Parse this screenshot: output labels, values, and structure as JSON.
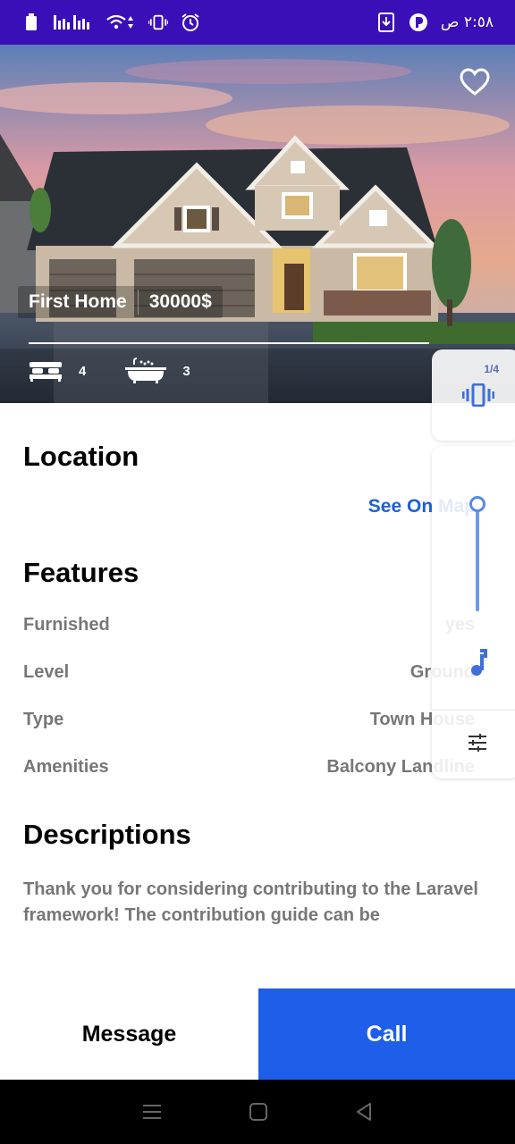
{
  "status_bar": {
    "time": "٢:٥٨ ص"
  },
  "listing": {
    "title": "First Home",
    "price": "30000$",
    "bedrooms": "4",
    "bathrooms": "3"
  },
  "location": {
    "heading": "Location",
    "map_link": "See On Map"
  },
  "features": {
    "heading": "Features",
    "items": [
      {
        "label": "Furnished",
        "value": "yes"
      },
      {
        "label": "Level",
        "value": "Ground"
      },
      {
        "label": "Type",
        "value": "Town House"
      },
      {
        "label": "Amenities",
        "value": "Balcony Landline"
      }
    ]
  },
  "descriptions": {
    "heading": "Descriptions",
    "text": "Thank you for considering contributing to the Laravel framework! The contribution guide can be"
  },
  "overlay": {
    "counter": "1/4"
  },
  "actions": {
    "message_label": "Message",
    "call_label": "Call"
  },
  "colors": {
    "status_bar": "#3a0fb7",
    "accent": "#1e5ee8",
    "link": "#1e5fd6"
  }
}
